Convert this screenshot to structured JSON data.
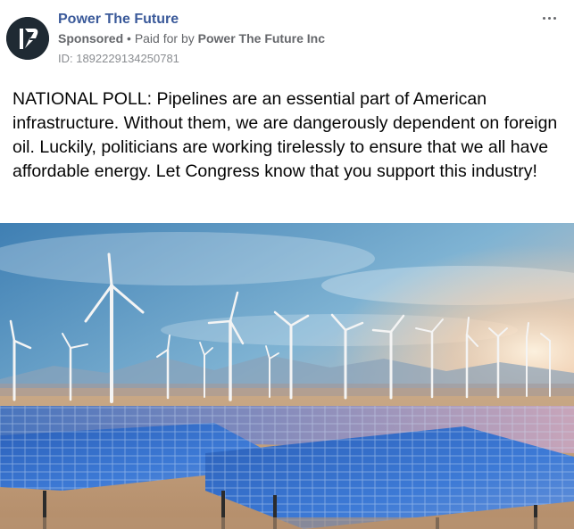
{
  "header": {
    "page_name": "Power The Future",
    "sponsored_label": "Sponsored",
    "separator": "•",
    "paid_for_prefix": "Paid for by",
    "advertiser": "Power The Future Inc",
    "ad_id": "ID: 1892229134250781",
    "more_icon": "more-horizontal-icon"
  },
  "post": {
    "text": "NATIONAL POLL: Pipelines are an essential part of American infrastructure. Without them, we are dangerously dependent on foreign oil. Luckily, politicians are working tirelessly to ensure that we all have affordable energy. Let Congress know that you support this industry!"
  },
  "colors": {
    "page_name": "#3b5a9a",
    "meta": "#65676b",
    "avatar_bg": "#1f2a33",
    "text": "#050505"
  }
}
